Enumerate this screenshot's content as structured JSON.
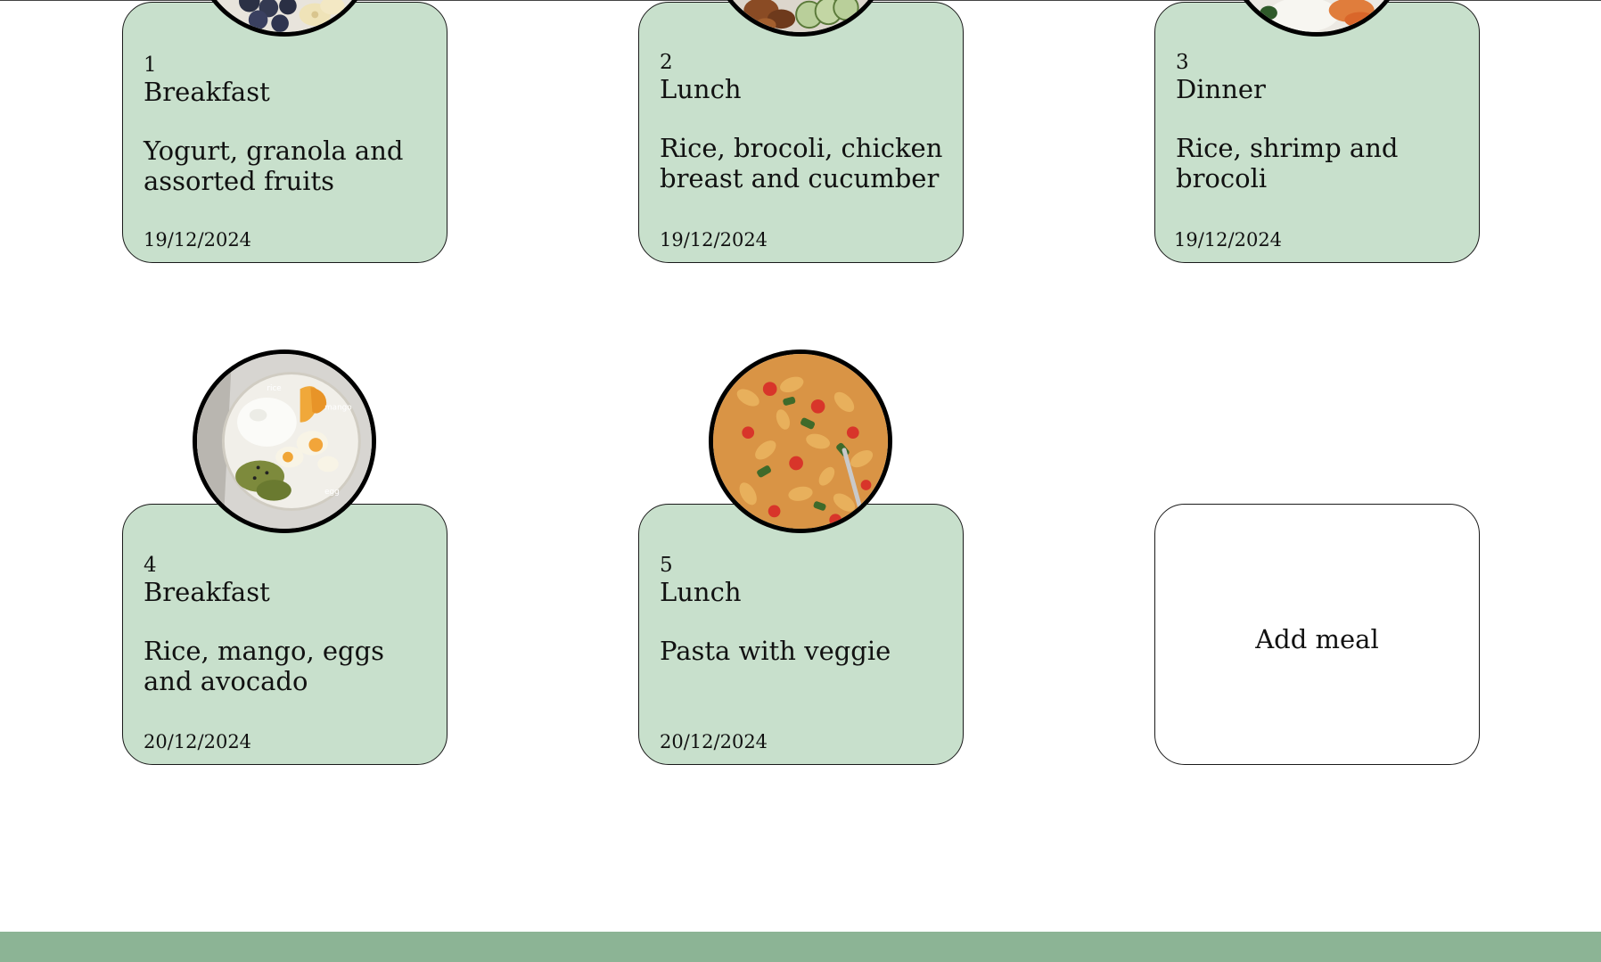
{
  "meals": [
    {
      "number": "1",
      "type": "Breakfast",
      "description": "Yogurt, granola and assorted fruits",
      "date": "19/12/2024",
      "photo_icon": "yogurt-fruit-bowl-photo"
    },
    {
      "number": "2",
      "type": "Lunch",
      "description": "Rice, brocoli, chicken breast and cucumber",
      "date": "19/12/2024",
      "photo_icon": "chicken-cucumber-plate-photo"
    },
    {
      "number": "3",
      "type": "Dinner",
      "description": "Rice, shrimp and brocoli",
      "date": "19/12/2024",
      "photo_icon": "rice-shrimp-plate-photo"
    },
    {
      "number": "4",
      "type": "Breakfast",
      "description": "Rice, mango, eggs and avocado",
      "date": "20/12/2024",
      "photo_icon": "rice-mango-egg-plate-photo"
    },
    {
      "number": "5",
      "type": "Lunch",
      "description": "Pasta with veggie",
      "date": "20/12/2024",
      "photo_icon": "pasta-veggie-photo"
    }
  ],
  "add_card": {
    "label": "Add meal"
  },
  "photo_4_labels": {
    "rice": "rice",
    "mango": "mango",
    "egg": "egg"
  },
  "colors": {
    "card_background": "#c8e0cc",
    "footer_bar": "#8cb495",
    "photo_border": "#000000"
  }
}
